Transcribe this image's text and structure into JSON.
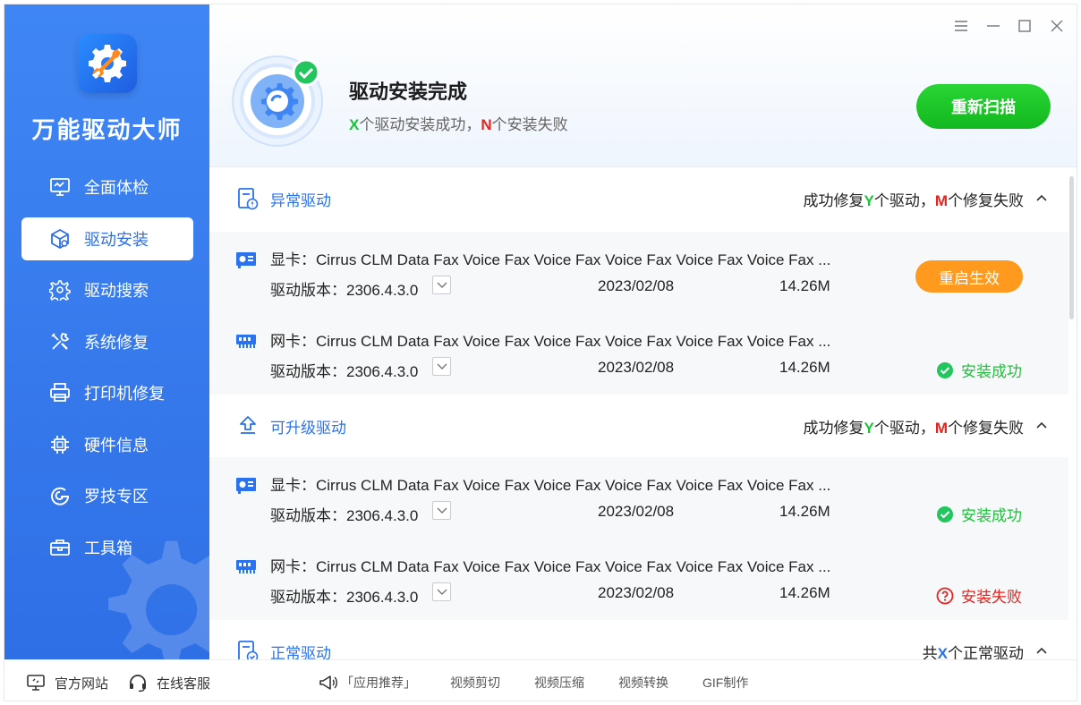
{
  "app": {
    "title": "万能驱动大师"
  },
  "nav": {
    "items": [
      {
        "label": "全面体检"
      },
      {
        "label": "驱动安装"
      },
      {
        "label": "驱动搜索"
      },
      {
        "label": "系统修复"
      },
      {
        "label": "打印机修复"
      },
      {
        "label": "硬件信息"
      },
      {
        "label": "罗技专区"
      },
      {
        "label": "工具箱"
      }
    ],
    "active": "驱动安装"
  },
  "header": {
    "title": "驱动安装完成",
    "sub_x": "X",
    "sub_a": "个驱动安装成功，",
    "sub_n": "N",
    "sub_b": "个安装失败",
    "rescan": "重新扫描"
  },
  "sections": {
    "abnormal": {
      "title": "异常驱动",
      "stat_a": "成功修复",
      "stat_y": "Y",
      "stat_b": "个驱动，",
      "stat_m": "M",
      "stat_c": "个修复失败",
      "rows": [
        {
          "name": "显卡：Cirrus CLM Data Fax Voice Fax Voice Fax Voice Fax Voice Fax Voice Fax ...",
          "version": "驱动版本：2306.4.3.0",
          "date": "2023/02/08",
          "size": "14.26M",
          "action": "重启生效"
        },
        {
          "name": "网卡：Cirrus CLM Data Fax Voice Fax Voice Fax Voice Fax Voice Fax Voice Fax ...",
          "version": "驱动版本：2306.4.3.0",
          "date": "2023/02/08",
          "size": "14.26M",
          "status": "安装成功"
        }
      ]
    },
    "upgradable": {
      "title": "可升级驱动",
      "stat_a": "成功修复",
      "stat_y": "Y",
      "stat_b": "个驱动，",
      "stat_m": "M",
      "stat_c": "个修复失败",
      "rows": [
        {
          "name": "显卡：Cirrus CLM Data Fax Voice Fax Voice Fax Voice Fax Voice Fax Voice Fax ...",
          "version": "驱动版本：2306.4.3.0",
          "date": "2023/02/08",
          "size": "14.26M",
          "status": "安装成功"
        },
        {
          "name": "网卡：Cirrus CLM Data Fax Voice Fax Voice Fax Voice Fax Voice Fax Voice Fax ...",
          "version": "驱动版本：2306.4.3.0",
          "date": "2023/02/08",
          "size": "14.26M",
          "status": "安装失败"
        }
      ]
    },
    "normal": {
      "title": "正常驱动",
      "stat_a": "共",
      "stat_x": "X",
      "stat_b": "个正常驱动"
    }
  },
  "footer": {
    "official_site": "官方网站",
    "support": "在线客服",
    "recommend": "「应用推荐」",
    "tools": [
      "视频剪切",
      "视频压缩",
      "视频转换",
      "GIF制作"
    ]
  },
  "colors": {
    "sidebar": "#3f86f4",
    "accent_blue": "#2a72ee",
    "success": "#1fc13b",
    "fail": "#e7221d",
    "warning": "#ff9a1f"
  }
}
